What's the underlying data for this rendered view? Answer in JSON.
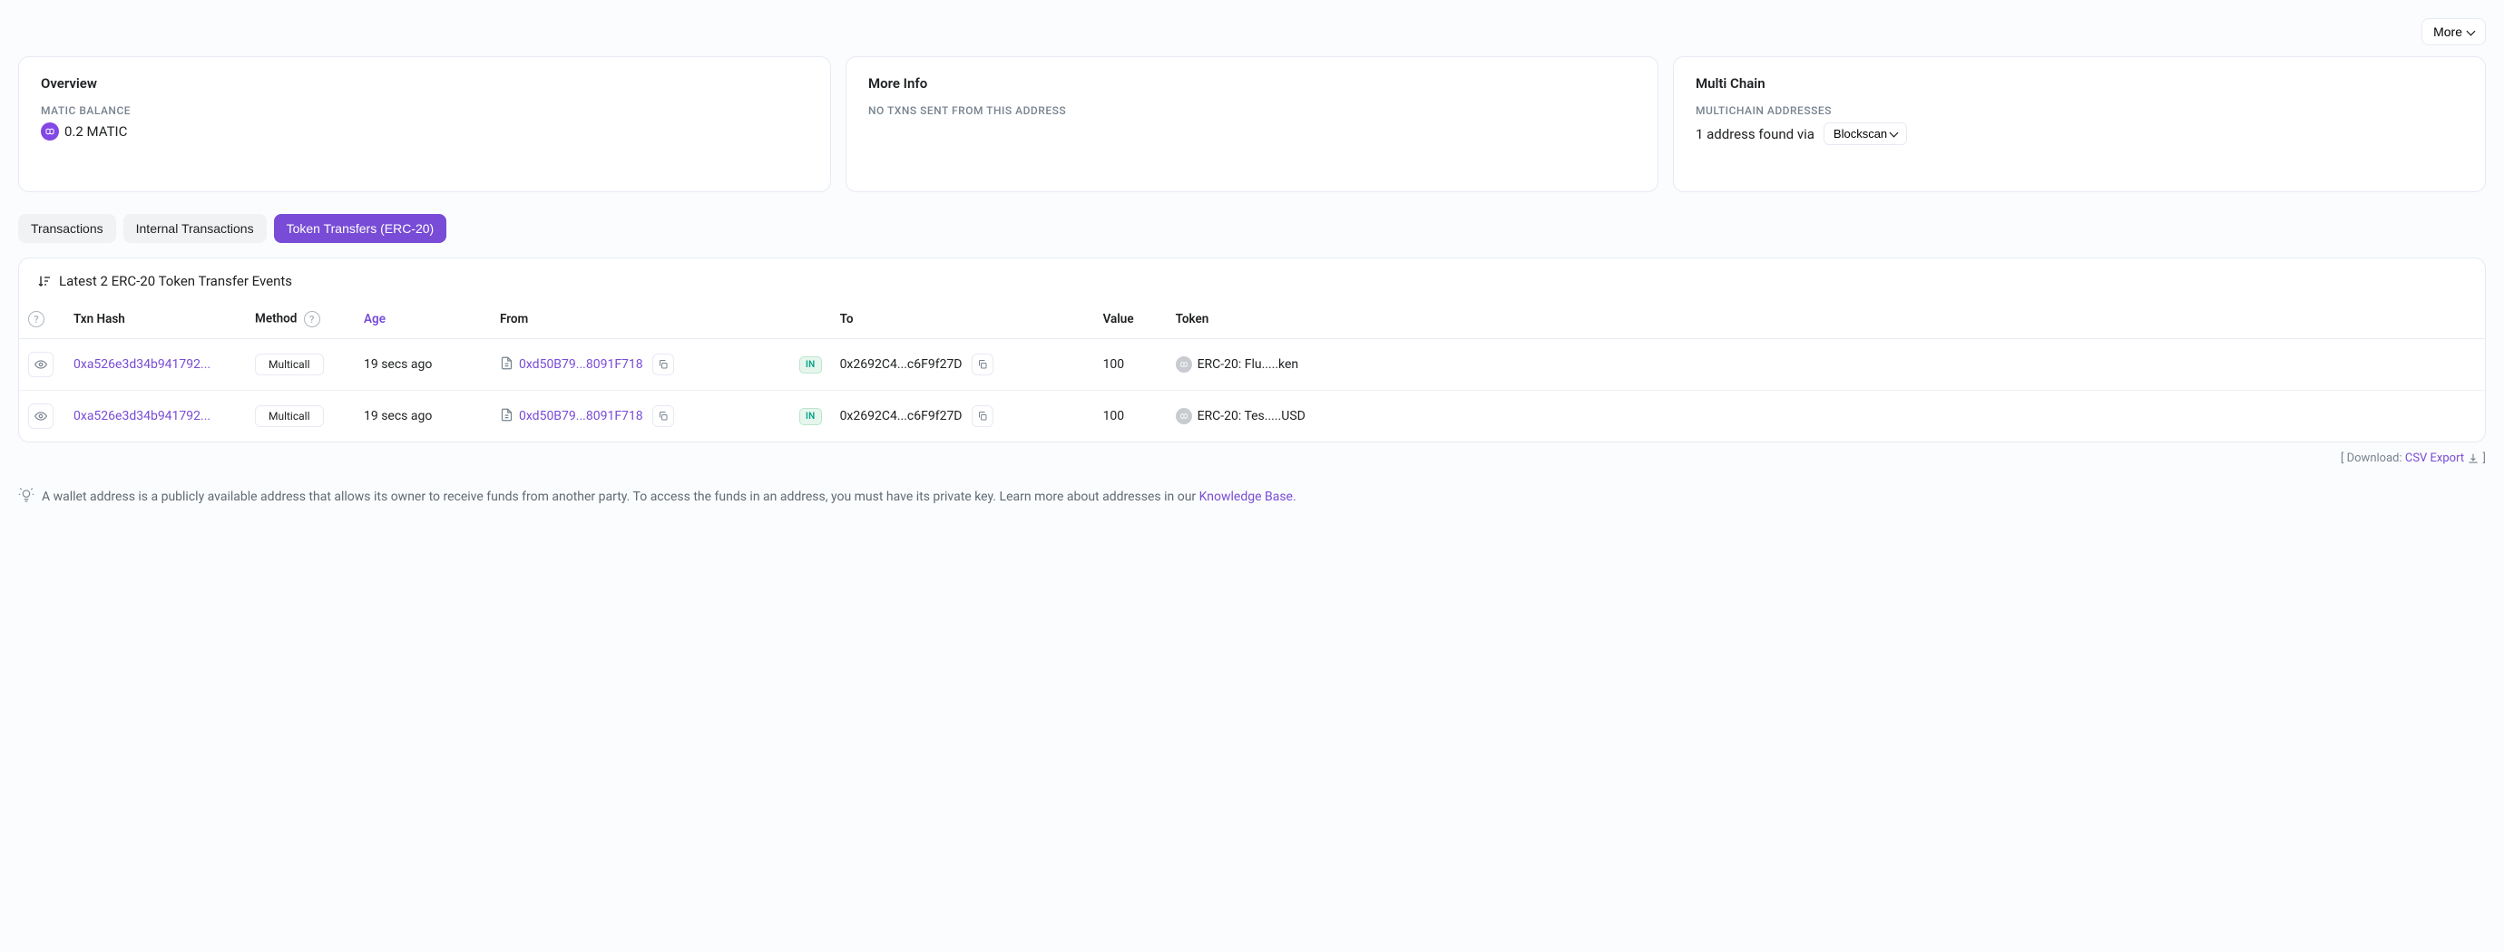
{
  "topActions": {
    "more": "More"
  },
  "cards": {
    "overview": {
      "title": "Overview",
      "balanceLabel": "MATIC BALANCE",
      "balanceValue": "0.2 MATIC"
    },
    "moreInfo": {
      "title": "More Info",
      "noTxns": "NO TXNS SENT FROM THIS ADDRESS"
    },
    "multiChain": {
      "title": "Multi Chain",
      "label": "MULTICHAIN ADDRESSES",
      "foundText": "1 address found via",
      "blockscan": "Blockscan"
    }
  },
  "tabs": {
    "transactions": "Transactions",
    "internal": "Internal Transactions",
    "tokenTransfers": "Token Transfers (ERC-20)"
  },
  "panel": {
    "title": "Latest 2 ERC-20 Token Transfer Events",
    "headers": {
      "txnHash": "Txn Hash",
      "method": "Method",
      "age": "Age",
      "from": "From",
      "to": "To",
      "value": "Value",
      "token": "Token"
    },
    "rows": [
      {
        "hash": "0xa526e3d34b941792...",
        "method": "Multicall",
        "age": "19 secs ago",
        "from": "0xd50B79...8091F718",
        "direction": "IN",
        "to": "0x2692C4...c6F9f27D",
        "value": "100",
        "token": "ERC-20: Flu.....ken"
      },
      {
        "hash": "0xa526e3d34b941792...",
        "method": "Multicall",
        "age": "19 secs ago",
        "from": "0xd50B79...8091F718",
        "direction": "IN",
        "to": "0x2692C4...c6F9f27D",
        "value": "100",
        "token": "ERC-20: Tes.....USD"
      }
    ]
  },
  "download": {
    "prefix": "[ Download: ",
    "link": "CSV Export",
    "suffix": " ]"
  },
  "footer": {
    "text": "A wallet address is a publicly available address that allows its owner to receive funds from another party. To access the funds in an address, you must have its private key. Learn more about addresses in our ",
    "link": "Knowledge Base."
  }
}
